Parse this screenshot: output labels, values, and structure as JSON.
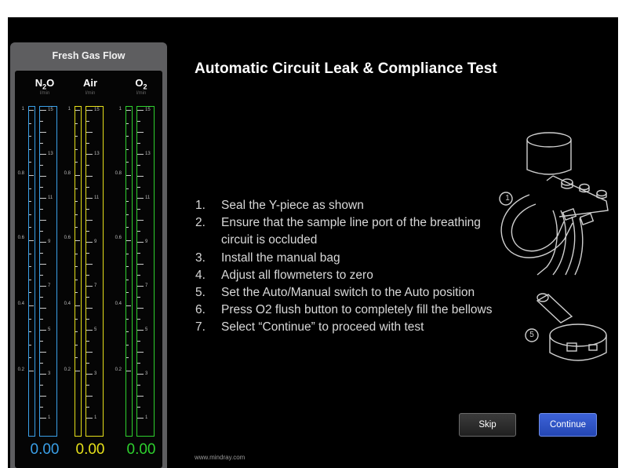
{
  "panel": {
    "title": "Fresh Gas Flow",
    "scale_left": [
      "1",
      "0.8",
      "0.6",
      "0.4",
      "0.2"
    ],
    "scale_right": [
      "15",
      "13",
      "11",
      "9",
      "7",
      "5",
      "3",
      "1"
    ],
    "gases": [
      {
        "name_main": "N",
        "name_sub": "2",
        "name_tail": "O",
        "unit": "l/min",
        "value": "0.00",
        "color": "#3aa0e8"
      },
      {
        "name_main": "Air",
        "name_sub": "",
        "name_tail": "",
        "unit": "l/min",
        "value": "0.00",
        "color": "#e6e01a"
      },
      {
        "name_main": "O",
        "name_sub": "2",
        "name_tail": "",
        "unit": "l/min",
        "value": "0.00",
        "color": "#2ed12e"
      }
    ]
  },
  "main": {
    "title": "Automatic Circuit Leak & Compliance Test",
    "steps": [
      {
        "num": "1.",
        "text": "Seal the Y-piece as shown"
      },
      {
        "num": "2.",
        "text": "Ensure that the sample line port of the breathing circuit is occluded"
      },
      {
        "num": "3.",
        "text": "Install the manual bag"
      },
      {
        "num": "4.",
        "text": "Adjust all flowmeters to zero"
      },
      {
        "num": "5.",
        "text": "Set the Auto/Manual switch to the Auto position"
      },
      {
        "num": "6.",
        "text": "Press O2 flush button to completely fill the bellows"
      },
      {
        "num": "7.",
        "text": "Select “Continue” to proceed with test"
      }
    ],
    "illustration_labels": [
      "1",
      "5"
    ]
  },
  "buttons": {
    "skip": "Skip",
    "continue": "Continue"
  },
  "footer": {
    "url": "www.mindray.com"
  },
  "colors": {
    "accent": "#2a4fc4",
    "n2o": "#3aa0e8",
    "air": "#e6e01a",
    "o2": "#2ed12e"
  }
}
